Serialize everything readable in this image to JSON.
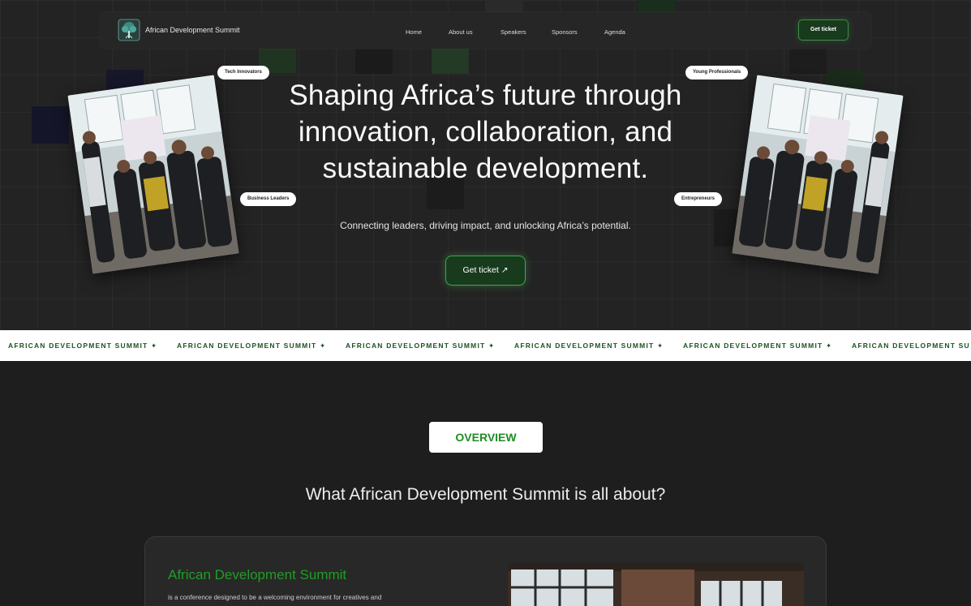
{
  "nav": {
    "brand": "African Development Summit",
    "links": [
      "Home",
      "About us",
      "Speakers",
      "Sponsors",
      "Agenda"
    ],
    "cta": "Get ticket",
    "logo_icon": "tree-icon"
  },
  "hero": {
    "headline": "Shaping Africa’s future through innovation, collaboration, and sustainable development.",
    "subheading": "Connecting leaders, driving impact, and unlocking Africa’s potential.",
    "cta": "Get ticket ↗",
    "tags": [
      "Tech Innovators",
      "Business Leaders",
      "Young Professionals",
      "Entrepreneurs"
    ]
  },
  "marquee": {
    "text": "AFRICAN DEVELOPMENT SUMMIT ✦",
    "last_text": "AFRICAN DEVELOPMENT SU"
  },
  "overview": {
    "badge": "OVERVIEW",
    "title": "What African Development Summit is all about?",
    "card_title": "African Development Summit",
    "card_text": "is a conference designed to be a welcoming environment for creatives and"
  },
  "colors": {
    "background": "#1f1f1f",
    "accent_green": "#1f9e23",
    "button_green": "#183a1d",
    "marquee_text": "#1c5324"
  }
}
